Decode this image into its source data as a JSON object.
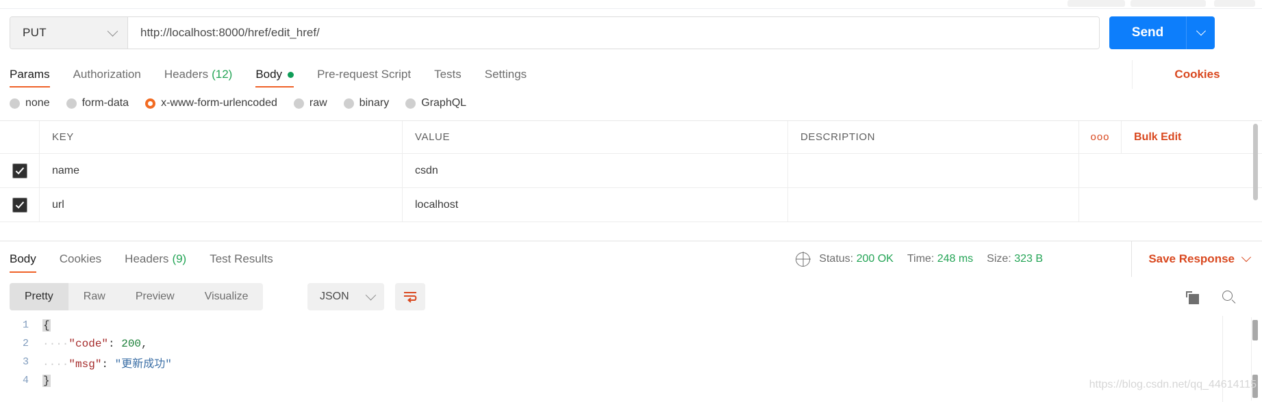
{
  "request": {
    "method": "PUT",
    "url": "http://localhost:8000/href/edit_href/",
    "send_label": "Send",
    "tabs": [
      {
        "label": "Params",
        "count": "",
        "active": false,
        "dot": false
      },
      {
        "label": "Authorization",
        "count": "",
        "active": false,
        "dot": false
      },
      {
        "label": "Headers",
        "count": "(12)",
        "active": false,
        "dot": false
      },
      {
        "label": "Body",
        "count": "",
        "active": true,
        "dot": true
      },
      {
        "label": "Pre-request Script",
        "count": "",
        "active": false,
        "dot": false
      },
      {
        "label": "Tests",
        "count": "",
        "active": false,
        "dot": false
      },
      {
        "label": "Settings",
        "count": "",
        "active": false,
        "dot": false
      }
    ],
    "cookies_label": "Cookies",
    "body_types": [
      {
        "label": "none",
        "selected": false
      },
      {
        "label": "form-data",
        "selected": false
      },
      {
        "label": "x-www-form-urlencoded",
        "selected": true
      },
      {
        "label": "raw",
        "selected": false
      },
      {
        "label": "binary",
        "selected": false
      },
      {
        "label": "GraphQL",
        "selected": false
      }
    ],
    "table": {
      "headers": {
        "key": "KEY",
        "value": "VALUE",
        "description": "DESCRIPTION"
      },
      "dots_icon": "ooo",
      "bulk_edit_label": "Bulk Edit",
      "rows": [
        {
          "checked": true,
          "key": "name",
          "value": "csdn",
          "description": ""
        },
        {
          "checked": true,
          "key": "url",
          "value": "localhost",
          "description": ""
        }
      ]
    }
  },
  "response": {
    "tabs": [
      {
        "label": "Body",
        "count": "",
        "active": true
      },
      {
        "label": "Cookies",
        "count": "",
        "active": false
      },
      {
        "label": "Headers",
        "count": "(9)",
        "active": false
      },
      {
        "label": "Test Results",
        "count": "",
        "active": false
      }
    ],
    "status_label": "Status:",
    "status_value": "200 OK",
    "time_label": "Time:",
    "time_value": "248 ms",
    "size_label": "Size:",
    "size_value": "323 B",
    "save_response_label": "Save Response",
    "view_modes": [
      {
        "label": "Pretty",
        "active": true
      },
      {
        "label": "Raw",
        "active": false
      },
      {
        "label": "Preview",
        "active": false
      },
      {
        "label": "Visualize",
        "active": false
      }
    ],
    "format": "JSON",
    "code_lines": [
      {
        "no": "1",
        "indent": "",
        "fold": "{",
        "text": ""
      },
      {
        "no": "2",
        "indent": "····",
        "key": "\"code\"",
        "sep": ": ",
        "num": "200",
        "tail": ","
      },
      {
        "no": "3",
        "indent": "····",
        "key": "\"msg\"",
        "sep": ": ",
        "str": "\"更新成功\"",
        "tail": ""
      },
      {
        "no": "4",
        "indent": "",
        "fold": "}",
        "text": ""
      }
    ]
  },
  "watermark": "https://blog.csdn.net/qq_44614115",
  "colors": {
    "accent_orange": "#ef6228",
    "link_orange": "#d9481f",
    "send_blue": "#0d7efb",
    "green": "#23a455"
  }
}
